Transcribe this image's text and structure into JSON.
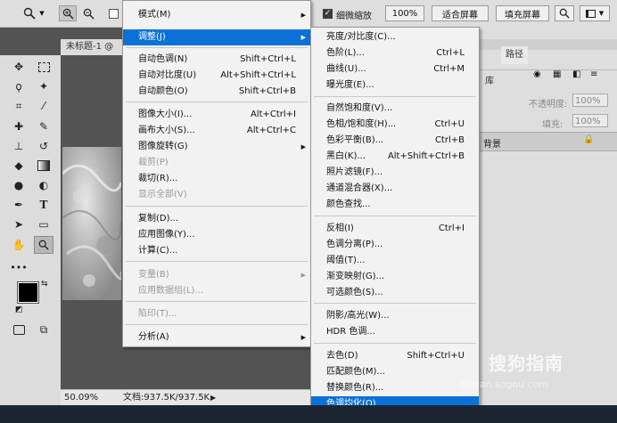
{
  "options_bar": {
    "zoom_icon_tool": "zoom-icon",
    "checkbox_label": "细微缩放",
    "zoom_value": "100%",
    "fit_screen": "适合屏幕",
    "fill_screen": "填充屏幕"
  },
  "document": {
    "tab_title": "未标题-1 @",
    "zoom": "50.09%",
    "doc_info": "文档:937.5K/937.5K"
  },
  "right_panel": {
    "tab_library": "库",
    "tab_paths": "路径",
    "opacity_label": "不透明度:",
    "opacity_value": "100%",
    "fill_label": "填充:",
    "fill_value": "100%",
    "layer_name": "背景"
  },
  "image_menu": {
    "items": [
      {
        "label": "模式(M)",
        "submenu": true
      },
      {
        "label": "调整(J)",
        "submenu": true,
        "highlighted": true
      },
      {
        "label": "自动色调(N)",
        "shortcut": "Shift+Ctrl+L"
      },
      {
        "label": "自动对比度(U)",
        "shortcut": "Alt+Shift+Ctrl+L"
      },
      {
        "label": "自动颜色(O)",
        "shortcut": "Shift+Ctrl+B"
      },
      {
        "label": "图像大小(I)...",
        "shortcut": "Alt+Ctrl+I"
      },
      {
        "label": "画布大小(S)...",
        "shortcut": "Alt+Ctrl+C"
      },
      {
        "label": "图像旋转(G)",
        "submenu": true
      },
      {
        "label": "裁剪(P)",
        "disabled": true
      },
      {
        "label": "裁切(R)..."
      },
      {
        "label": "显示全部(V)",
        "disabled": true
      },
      {
        "label": "复制(D)..."
      },
      {
        "label": "应用图像(Y)..."
      },
      {
        "label": "计算(C)..."
      },
      {
        "label": "变量(B)",
        "submenu": true,
        "disabled": true
      },
      {
        "label": "应用数据组(L)...",
        "disabled": true
      },
      {
        "label": "陷印(T)...",
        "disabled": true
      },
      {
        "label": "分析(A)",
        "submenu": true
      }
    ]
  },
  "adjust_menu": {
    "items": [
      {
        "label": "亮度/对比度(C)..."
      },
      {
        "label": "色阶(L)...",
        "shortcut": "Ctrl+L"
      },
      {
        "label": "曲线(U)...",
        "shortcut": "Ctrl+M"
      },
      {
        "label": "曝光度(E)..."
      },
      {
        "label": "自然饱和度(V)..."
      },
      {
        "label": "色相/饱和度(H)...",
        "shortcut": "Ctrl+U"
      },
      {
        "label": "色彩平衡(B)...",
        "shortcut": "Ctrl+B"
      },
      {
        "label": "黑白(K)...",
        "shortcut": "Alt+Shift+Ctrl+B"
      },
      {
        "label": "照片滤镜(F)..."
      },
      {
        "label": "通道混合器(X)..."
      },
      {
        "label": "颜色查找..."
      },
      {
        "label": "反相(I)",
        "shortcut": "Ctrl+I"
      },
      {
        "label": "色调分离(P)..."
      },
      {
        "label": "阈值(T)..."
      },
      {
        "label": "渐变映射(G)..."
      },
      {
        "label": "可选颜色(S)..."
      },
      {
        "label": "阴影/高光(W)..."
      },
      {
        "label": "HDR 色调..."
      },
      {
        "label": "去色(D)",
        "shortcut": "Shift+Ctrl+U"
      },
      {
        "label": "匹配颜色(M)..."
      },
      {
        "label": "替换颜色(R)..."
      },
      {
        "label": "色调均化(Q)",
        "highlighted": true
      }
    ]
  },
  "watermark": {
    "brand": "搜狗指南",
    "url": "zhinan.sogou.com"
  },
  "colors": {
    "highlight": "#0a72d6",
    "workspace": "#535353",
    "menu_bg": "#f2f2f2"
  }
}
